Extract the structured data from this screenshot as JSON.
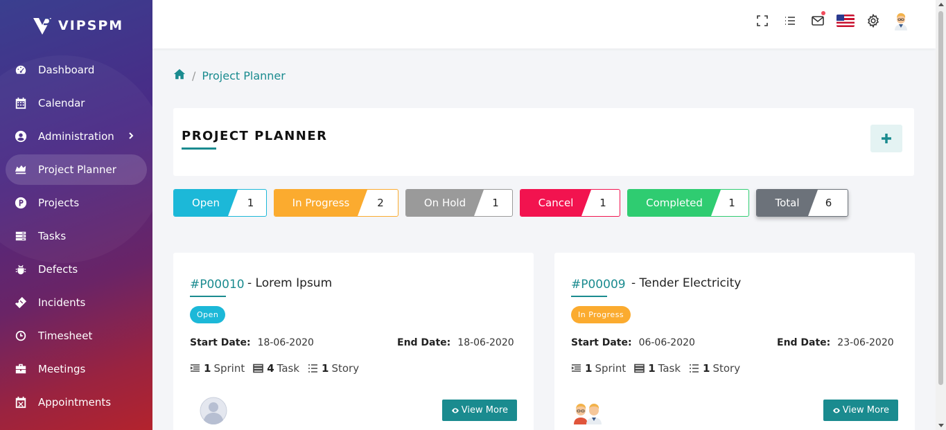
{
  "app": {
    "logo_text": "VIPSPM"
  },
  "sidebar": {
    "items": [
      {
        "label": "Dashboard",
        "icon": "dashboard-icon"
      },
      {
        "label": "Calendar",
        "icon": "calendar-icon"
      },
      {
        "label": "Administration",
        "icon": "user-circle-icon",
        "has_submenu": true
      },
      {
        "label": "Project Planner",
        "icon": "planner-icon",
        "active": true
      },
      {
        "label": "Projects",
        "icon": "p-circle-icon"
      },
      {
        "label": "Tasks",
        "icon": "tasks-icon"
      },
      {
        "label": "Defects",
        "icon": "bug-icon"
      },
      {
        "label": "Incidents",
        "icon": "ticket-icon"
      },
      {
        "label": "Timesheet",
        "icon": "clock-icon"
      },
      {
        "label": "Meetings",
        "icon": "briefcase-icon"
      },
      {
        "label": "Appointments",
        "icon": "calendar-x-icon"
      }
    ]
  },
  "header": {
    "icons": [
      "fullscreen-icon",
      "list-icon",
      "mail-icon",
      "us-flag-icon",
      "gear-icon",
      "user-avatar"
    ]
  },
  "breadcrumb": {
    "home_icon": "home-icon",
    "current": "Project Planner"
  },
  "page": {
    "title": "PROJECT PLANNER",
    "add_icon": "plus-icon"
  },
  "status_filters": [
    {
      "label": "Open",
      "count": "1",
      "color": "#1cb8d8"
    },
    {
      "label": "In Progress",
      "count": "2",
      "color": "#fbab2f"
    },
    {
      "label": "On Hold",
      "count": "1",
      "color": "#9a9a9a"
    },
    {
      "label": "Cancel",
      "count": "1",
      "color": "#f2134f"
    },
    {
      "label": "Completed",
      "count": "1",
      "color": "#2fcc71"
    },
    {
      "label": "Total",
      "count": "6",
      "color": "#6c727a"
    }
  ],
  "projects": [
    {
      "code": "#P00010",
      "name": "- Lorem Ipsum",
      "status": "Open",
      "status_color": "#1cb8d8",
      "start_label": "Start Date:",
      "start_date": "18-06-2020",
      "end_label": "End Date:",
      "end_date": "18-06-2020",
      "sprint_count": "1",
      "sprint_label": "Sprint",
      "task_count": "4",
      "task_label": "Task",
      "story_count": "1",
      "story_label": "Story",
      "button_label": "View More"
    },
    {
      "code": "#P00009",
      "name": "- Tender Electricity",
      "status": "In Progress",
      "status_color": "#fbab2f",
      "start_label": "Start Date:",
      "start_date": "06-06-2020",
      "end_label": "End Date:",
      "end_date": "23-06-2020",
      "sprint_count": "1",
      "sprint_label": "Sprint",
      "task_count": "1",
      "task_label": "Task",
      "story_count": "1",
      "story_label": "Story",
      "button_label": "View More"
    }
  ],
  "colors": {
    "accent": "#1a8b8f"
  }
}
